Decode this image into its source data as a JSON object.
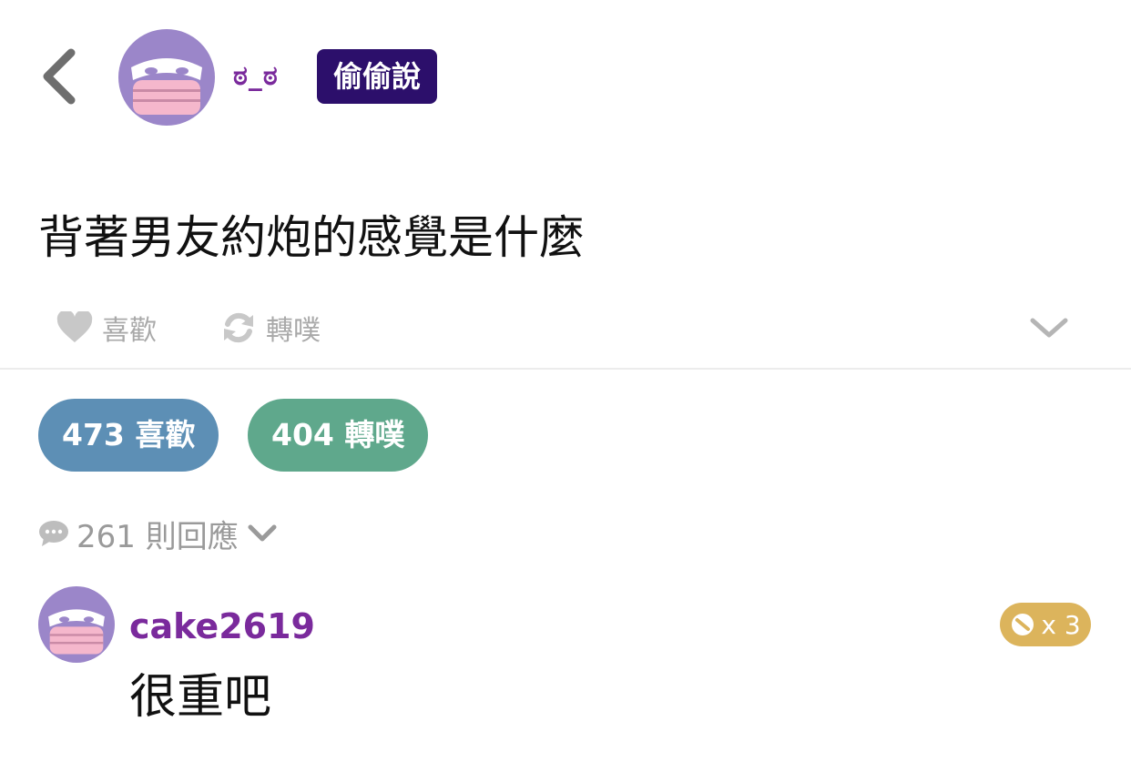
{
  "colors": {
    "author_purple": "#7a2a9c",
    "badge_dark_purple": "#2c0f6b",
    "avatar_purple": "#9b86c9",
    "avatar_pink": "#f5b7cc",
    "like_pill": "#5d8fb5",
    "replurk_pill": "#5fa88c",
    "karma_gold": "#dcb45c",
    "muted_gray": "#a9a9a9"
  },
  "header": {
    "back_icon": "chevron-left-icon",
    "author_name": "ಠ_ಠ",
    "anonymous_badge": "偷偷說"
  },
  "post": {
    "content": "背著男友約炮的感覺是什麼"
  },
  "actions": {
    "like_icon": "heart-icon",
    "like_label": "喜歡",
    "replurk_icon": "refresh-icon",
    "replurk_label": "轉噗",
    "expand_icon": "chevron-down-icon"
  },
  "stats": {
    "likes": "473 喜歡",
    "replurks": "404 轉噗"
  },
  "responses": {
    "icon": "speech-bubble-icon",
    "label": "261 則回應",
    "toggle_icon": "chevron-down-icon"
  },
  "comment": {
    "username": "cake2619",
    "karma_icon": "karma-icon",
    "karma": "x 3",
    "text": "很重吧"
  }
}
